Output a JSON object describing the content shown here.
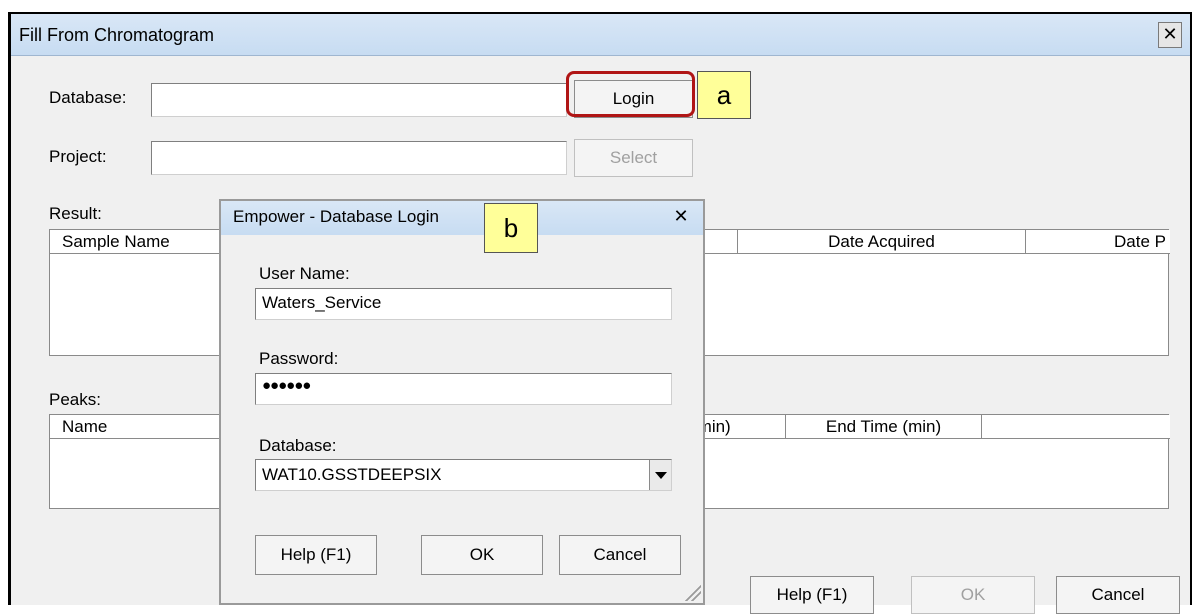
{
  "main_window": {
    "title": "Fill From Chromatogram",
    "close_glyph": "✕",
    "database_label": "Database:",
    "database_value": "",
    "login_button": "Login",
    "project_label": "Project:",
    "project_value": "",
    "select_button": "Select",
    "result_label": "Result:",
    "result_columns": [
      "Sample Name",
      "...",
      "Date Acquired",
      "Date P"
    ],
    "peaks_label": "Peaks:",
    "peaks_columns": [
      "Name",
      "(min)",
      "End Time (min)",
      ""
    ],
    "help_button": "Help (F1)",
    "ok_button": "OK",
    "cancel_button": "Cancel"
  },
  "callouts": {
    "a": "a",
    "b": "b"
  },
  "login_dialog": {
    "title": "Empower - Database Login",
    "close_glyph": "✕",
    "user_name_label": "User Name:",
    "user_name_value": "Waters_Service",
    "password_label": "Password:",
    "password_value": "●●●●●●",
    "database_label": "Database:",
    "database_value": "WAT10.GSSTDEEPSIX",
    "help_button": "Help (F1)",
    "ok_button": "OK",
    "cancel_button": "Cancel"
  },
  "colors": {
    "highlight": "#b01515",
    "callout_fill": "#ffff99",
    "titlebar": "#c7dcf2"
  },
  "icons": {
    "close": "close-icon",
    "dropdown": "chevron-down-icon",
    "grip": "resize-grip-icon"
  }
}
